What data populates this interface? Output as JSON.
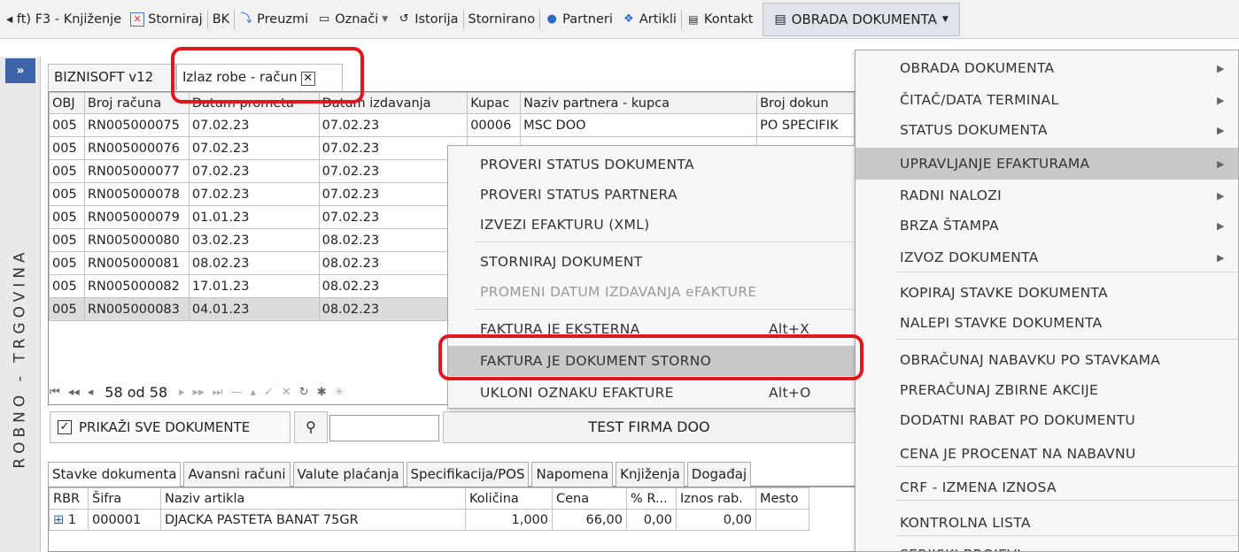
{
  "toolbar": {
    "items": [
      {
        "label": "◂ ft) F3 - Knjiženje",
        "icon": ""
      },
      {
        "label": "Storniraj",
        "icon": "storno-icon"
      },
      {
        "label": "BK",
        "icon": ""
      },
      {
        "label": "Preuzmi",
        "icon": "download-icon"
      },
      {
        "label": "Označi",
        "icon": "mark-icon"
      },
      {
        "label": "Istorija",
        "icon": "history-icon"
      },
      {
        "label": "Stornirano",
        "icon": ""
      },
      {
        "label": "Partneri",
        "icon": "user-icon"
      },
      {
        "label": "Artikli",
        "icon": "dropbox-icon"
      },
      {
        "label": "Kontakt",
        "icon": "contact-card-icon"
      }
    ],
    "obrada_label": "OBRADA DOKUMENTA"
  },
  "sidebar": {
    "collapse": "»",
    "vertical_label": "ROBNO - TRGOVINA"
  },
  "doc_tabs": {
    "tab1": "BIZNISOFT v12",
    "tab2": "Izlaz robe - račun",
    "close": "✕"
  },
  "grid": {
    "columns": [
      "OBJ",
      "Broj računa",
      "Datum prometa",
      "Datum izdavanja",
      "Kupac",
      "Naziv partnera - kupca",
      "Broj dokun"
    ],
    "rows": [
      [
        "005",
        "RN005000075",
        "07.02.23",
        "07.02.23",
        "00006",
        "MSC DOO",
        "PO SPECIFIK"
      ],
      [
        "005",
        "RN005000076",
        "07.02.23",
        "07.02.23",
        "",
        "",
        ""
      ],
      [
        "005",
        "RN005000077",
        "07.02.23",
        "07.02.23",
        "",
        "",
        ""
      ],
      [
        "005",
        "RN005000078",
        "07.02.23",
        "07.02.23",
        "",
        "",
        ""
      ],
      [
        "005",
        "RN005000079",
        "01.01.23",
        "07.02.23",
        "",
        "",
        ""
      ],
      [
        "005",
        "RN005000080",
        "03.02.23",
        "08.02.23",
        "",
        "",
        ""
      ],
      [
        "005",
        "RN005000081",
        "08.02.23",
        "08.02.23",
        "",
        "",
        ""
      ],
      [
        "005",
        "RN005000082",
        "17.01.23",
        "08.02.23",
        "",
        "",
        ""
      ],
      [
        "005",
        "RN005000083",
        "04.01.23",
        "08.02.23",
        "",
        "",
        ""
      ]
    ],
    "navigator": "58 od 58"
  },
  "bottom": {
    "show_all": "PRIKAŽI SVE DOKUMENTE",
    "search_value": "",
    "firm": "TEST FIRMA DOO"
  },
  "lower_tabs": [
    "Stavke dokumenta",
    "Avansni računi",
    "Valute plaćanja",
    "Specifikacija/POS",
    "Napomena",
    "Knjiženja",
    "Događaj"
  ],
  "items_table": {
    "columns": [
      "RBR",
      "Šifra",
      "Naziv artikla",
      "Količina",
      "Cena",
      "% R...",
      "Iznos rab.",
      "Mesto"
    ],
    "rows": [
      [
        "1",
        "000001",
        "DJACKA PASTETA BANAT 75GR",
        "1,000",
        "66,00",
        "0,00",
        "0,00",
        ""
      ]
    ]
  },
  "context_menu": [
    {
      "label": "PROVERI STATUS DOKUMENTA",
      "shortcut": "",
      "disabled": false
    },
    {
      "label": "PROVERI STATUS PARTNERA",
      "shortcut": "",
      "disabled": false
    },
    {
      "label": "IZVEZI EFAKTURU (XML)",
      "shortcut": "",
      "disabled": false
    },
    {
      "label": "STORNIRAJ DOKUMENT",
      "shortcut": "",
      "disabled": false
    },
    {
      "label": "PROMENI DATUM IZDAVANJA eFAKTURE",
      "shortcut": "",
      "disabled": true
    },
    {
      "label": "FAKTURA JE EKSTERNA",
      "shortcut": "Alt+X",
      "disabled": false
    },
    {
      "label": "FAKTURA JE DOKUMENT STORNO",
      "shortcut": "",
      "disabled": false
    },
    {
      "label": "UKLONI OZNAKU EFAKTURE",
      "shortcut": "Alt+O",
      "disabled": false
    }
  ],
  "right_menu": [
    {
      "label": "OBRADA DOKUMENTA",
      "submenu": true
    },
    {
      "label": "ČITAČ/DATA TERMINAL",
      "submenu": true
    },
    {
      "label": "STATUS DOKUMENTA",
      "submenu": true
    },
    {
      "label": "UPRAVLJANJE EFAKTURAMA",
      "submenu": true
    },
    {
      "label": "RADNI NALOZI",
      "submenu": true
    },
    {
      "label": "BRZA ŠTAMPA",
      "submenu": true
    },
    {
      "label": "IZVOZ DOKUMENTA",
      "submenu": true
    },
    {
      "label": "KOPIRAJ STAVKE DOKUMENTA",
      "submenu": false
    },
    {
      "label": "NALEPI STAVKE DOKUMENTA",
      "submenu": false
    },
    {
      "label": "OBRAČUNAJ NABAVKU PO STAVKAMA",
      "submenu": false
    },
    {
      "label": "PRERAČUNAJ ZBIRNE AKCIJE",
      "submenu": false
    },
    {
      "label": "DODATNI RABAT PO DOKUMENTU",
      "submenu": false
    },
    {
      "label": "CENA JE PROCENAT NA NABAVNU",
      "submenu": false
    },
    {
      "label": "CRF - IZMENA IZNOSA",
      "submenu": false
    },
    {
      "label": "KONTROLNA LISTA",
      "submenu": false
    },
    {
      "label": "SERIJSKI BROJEVI",
      "submenu": true
    }
  ],
  "colors": {
    "highlight_red": "#e3161d",
    "accent_blue": "#3d64a8",
    "menu_hover": "#c9c9c9"
  }
}
